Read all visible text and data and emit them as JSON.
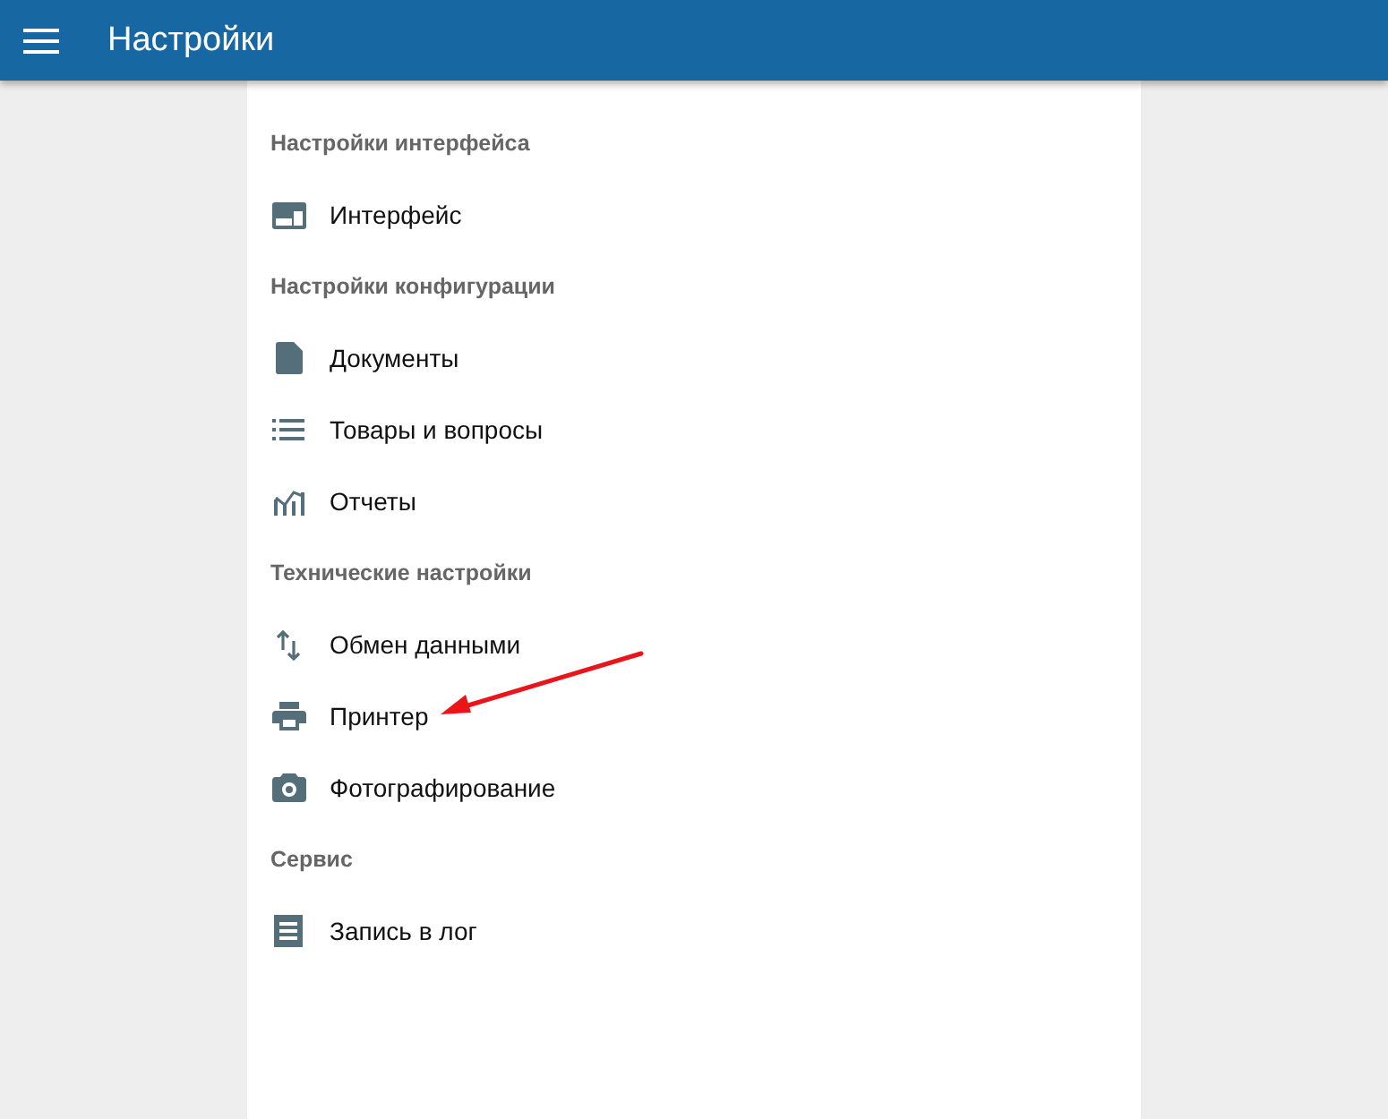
{
  "app_bar": {
    "title": "Настройки"
  },
  "sections": [
    {
      "title": "Настройки интерфейса",
      "items": [
        {
          "label": "Интерфейс"
        }
      ]
    },
    {
      "title": "Настройки конфигурации",
      "items": [
        {
          "label": "Документы"
        },
        {
          "label": "Товары и вопросы"
        },
        {
          "label": "Отчеты"
        }
      ]
    },
    {
      "title": "Технические настройки",
      "items": [
        {
          "label": "Обмен данными"
        },
        {
          "label": "Принтер"
        },
        {
          "label": "Фотографирование"
        }
      ]
    },
    {
      "title": "Сервис",
      "items": [
        {
          "label": "Запись в лог"
        }
      ]
    }
  ]
}
